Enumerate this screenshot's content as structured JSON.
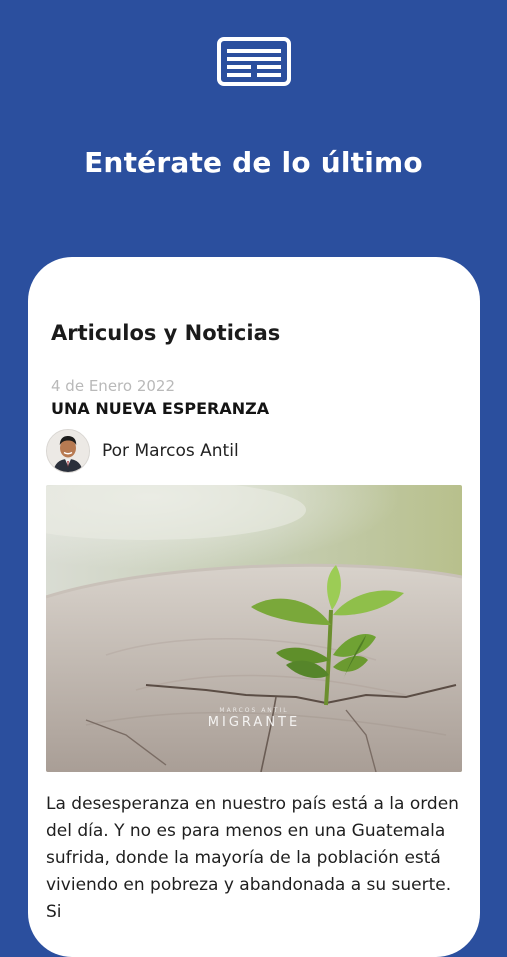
{
  "hero": {
    "icon": "newspaper-icon",
    "title": "Entérate de lo último"
  },
  "section": {
    "title": "Articulos y Noticias"
  },
  "post": {
    "date": "4 de Enero 2022",
    "title": "UNA NUEVA ESPERANZA",
    "author": "Por Marcos Antil",
    "image_watermark_small": "MARCOS ANTIL",
    "image_watermark": "MIGRANTE",
    "excerpt": "La desesperanza en nuestro país está a la orden del día. Y no es para menos en una Guatemala sufrida, donde la mayoría de la población está viviendo en pobreza y abandonada a su suerte. Si"
  },
  "colors": {
    "background": "#2b4f9e",
    "card": "#ffffff",
    "date": "#b9b9b9"
  }
}
